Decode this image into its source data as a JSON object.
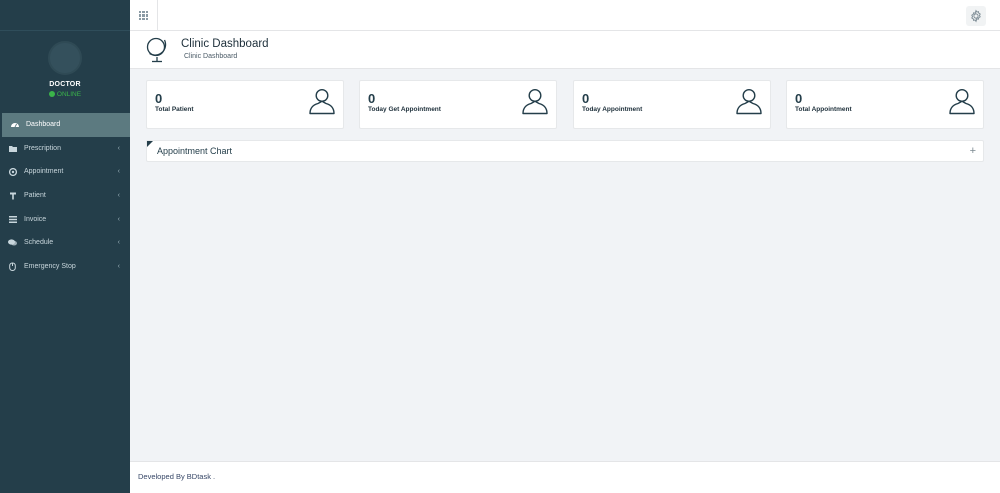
{
  "user": {
    "role": "DOCTOR",
    "status": "ONLINE"
  },
  "sidebar": {
    "items": [
      {
        "label": "Dashboard",
        "icon": "dashboard-icon",
        "active": true
      },
      {
        "label": "Prescription",
        "icon": "folder-icon"
      },
      {
        "label": "Appointment",
        "icon": "support-icon"
      },
      {
        "label": "Patient",
        "icon": "wheelchair-icon"
      },
      {
        "label": "Invoice",
        "icon": "list-icon"
      },
      {
        "label": "Schedule",
        "icon": "chat-icon"
      },
      {
        "label": "Emergency Stop",
        "icon": "pointer-icon"
      }
    ]
  },
  "header": {
    "title": "Clinic Dashboard",
    "subtitle": "Clinic Dashboard"
  },
  "cards": [
    {
      "count": "0",
      "label": "Total Patient"
    },
    {
      "count": "0",
      "label": "Today Get Appointment"
    },
    {
      "count": "0",
      "label": "Today Appointment"
    },
    {
      "count": "0",
      "label": "Total Appointment"
    }
  ],
  "panel": {
    "title": "Appointment Chart",
    "toggle": "+"
  },
  "footer": {
    "text": "Developed By BDtask ."
  },
  "colors": {
    "sidebar": "#243e4a",
    "active_item": "#5c7a80",
    "online": "#3bb44a",
    "background": "#f1f3f6"
  }
}
